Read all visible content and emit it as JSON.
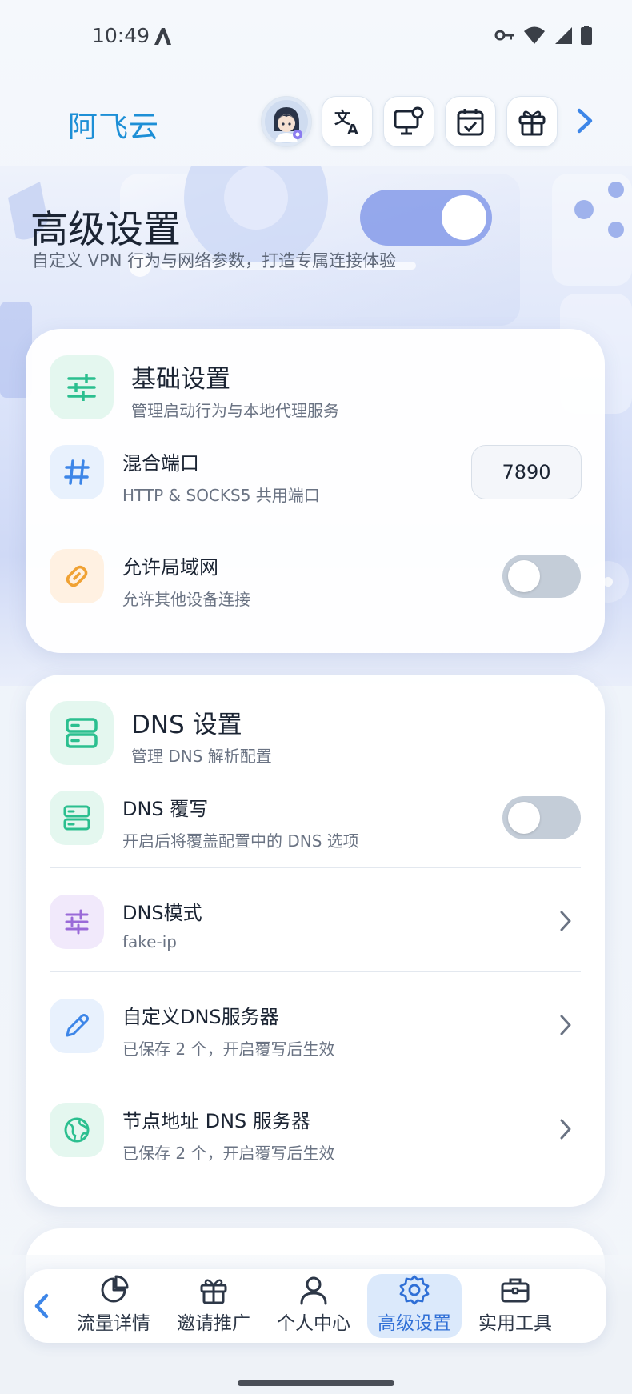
{
  "status_bar": {
    "time": "10:49"
  },
  "header": {
    "app_title": "阿飞云",
    "buttons": [
      "avatar",
      "translate-icon",
      "monitor-settings-icon",
      "calendar-check-icon",
      "gift-icon"
    ]
  },
  "hero": {
    "title": "高级设置",
    "subtitle": "自定义 VPN 行为与网络参数，打造专属连接体验"
  },
  "basic_card": {
    "title": "基础设置",
    "subtitle": "管理启动行为与本地代理服务",
    "rows": [
      {
        "title": "混合端口",
        "subtitle": "HTTP & SOCKS5 共用端口",
        "value": "7890",
        "icon": "hash-icon"
      },
      {
        "title": "允许局域网",
        "subtitle": "允许其他设备连接",
        "toggle": false,
        "icon": "link-icon"
      }
    ]
  },
  "dns_card": {
    "title": "DNS 设置",
    "subtitle": "管理 DNS 解析配置",
    "rows": [
      {
        "title": "DNS 覆写",
        "subtitle": "开启后将覆盖配置中的 DNS 选项",
        "toggle": false,
        "icon": "server-icon"
      },
      {
        "title": "DNS模式",
        "subtitle": "fake-ip",
        "icon": "sliders-icon"
      },
      {
        "title": "自定义DNS服务器",
        "subtitle": "已保存 2 个，开启覆写后生效",
        "icon": "pencil-icon"
      },
      {
        "title": "节点地址 DNS 服务器",
        "subtitle": "已保存 2 个，开启覆写后生效",
        "icon": "globe-icon"
      }
    ]
  },
  "bottom_nav": {
    "items": [
      {
        "label": "流量详情",
        "icon": "pie-chart-icon"
      },
      {
        "label": "邀请推广",
        "icon": "gift-icon"
      },
      {
        "label": "个人中心",
        "icon": "user-icon"
      },
      {
        "label": "高级设置",
        "icon": "gear-icon",
        "active": true
      },
      {
        "label": "实用工具",
        "icon": "toolbox-icon"
      }
    ]
  },
  "colors": {
    "accent": "#2f6fd6",
    "title_blue": "#1d8fd6",
    "green_icon": "#2bbf8f",
    "orange_icon": "#f0a234",
    "purple_icon": "#9a6ad8",
    "blue_icon": "#3d86e8"
  }
}
